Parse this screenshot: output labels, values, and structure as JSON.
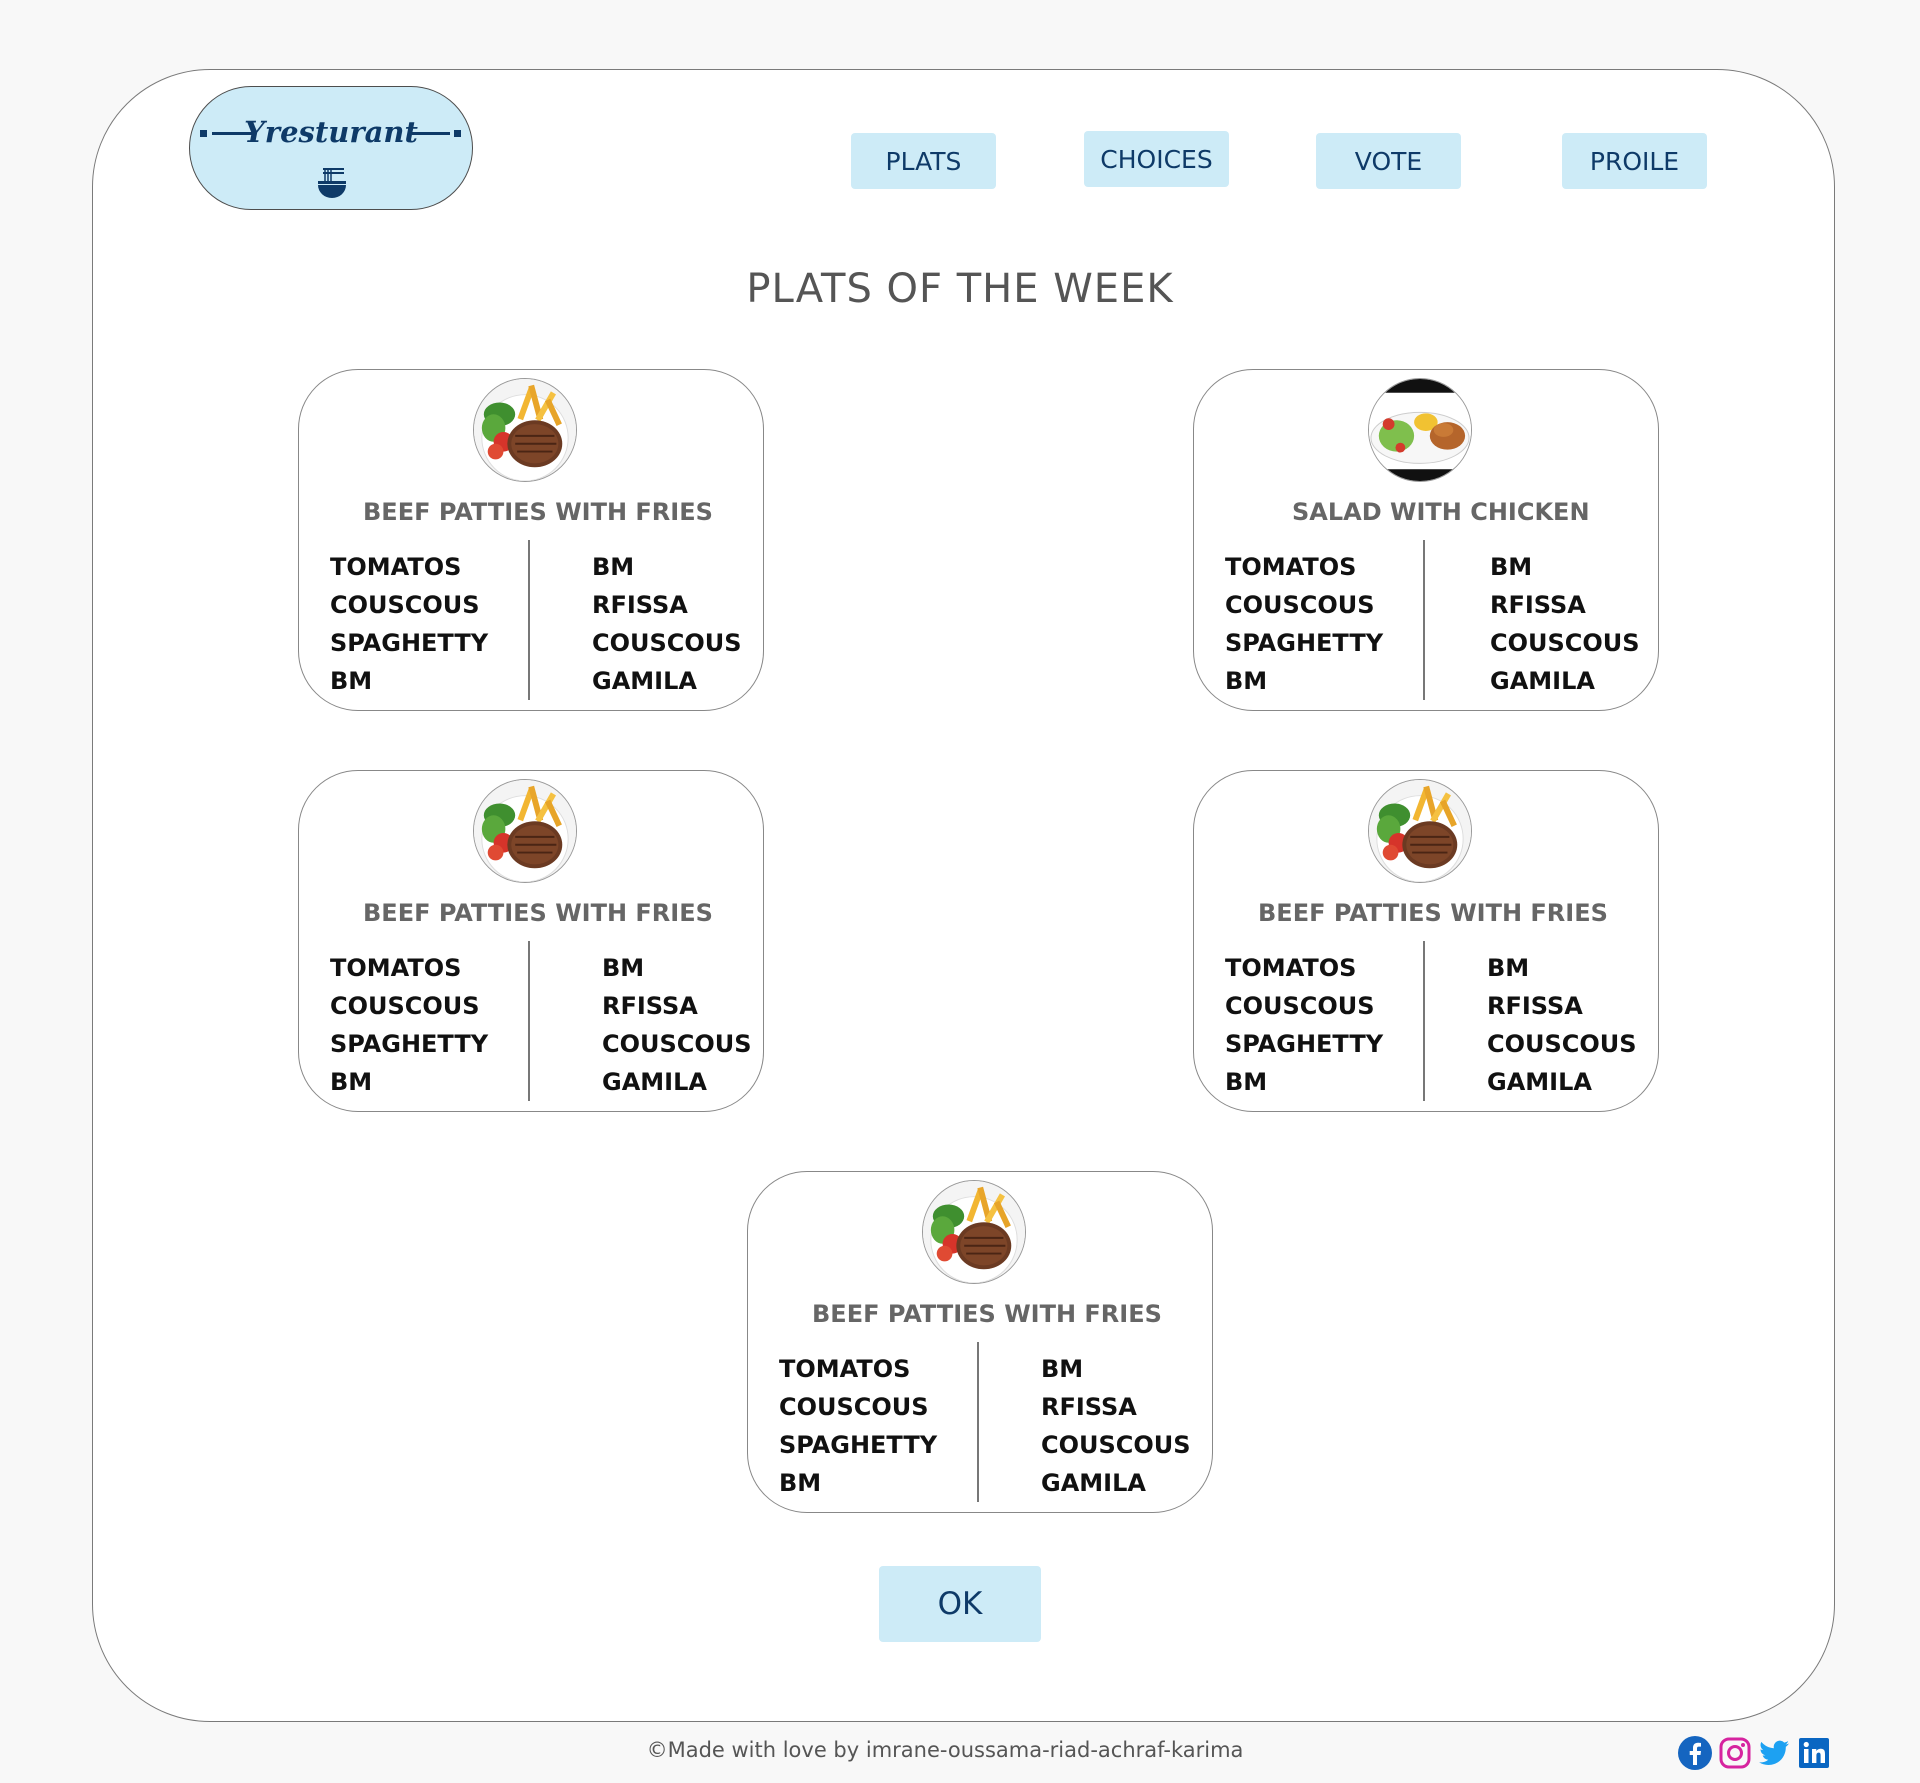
{
  "brand": {
    "name": "Yresturant",
    "icon": "noodle-bowl-icon",
    "color": "#0e3a68",
    "accent": "#cdebf7"
  },
  "nav": {
    "items": [
      "PLATS",
      "CHOICES",
      "VOTE",
      "PROILE"
    ]
  },
  "page": {
    "title": "PLATS OF THE WEEK"
  },
  "cards": [
    {
      "image": "beef-patties-image",
      "title": "BEEF PATTIES WITH FRIES",
      "left": [
        "TOMATOS",
        "COUSCOUS",
        "SPAGHETTY",
        "BM"
      ],
      "right": [
        "BM",
        "RFISSA",
        "COUSCOUS",
        "GAMILA"
      ]
    },
    {
      "image": "salad-chicken-image",
      "title": "SALAD WITH CHICKEN",
      "left": [
        "TOMATOS",
        "COUSCOUS",
        "SPAGHETTY",
        "BM"
      ],
      "right": [
        "BM",
        "RFISSA",
        "COUSCOUS",
        "GAMILA"
      ]
    },
    {
      "image": "beef-patties-image",
      "title": "BEEF PATTIES WITH FRIES",
      "left": [
        "TOMATOS",
        "COUSCOUS",
        "SPAGHETTY",
        "BM"
      ],
      "right": [
        "BM",
        "RFISSA",
        "COUSCOUS",
        "GAMILA"
      ]
    },
    {
      "image": "beef-patties-image",
      "title": "BEEF PATTIES WITH FRIES",
      "left": [
        "TOMATOS",
        "COUSCOUS",
        "SPAGHETTY",
        "BM"
      ],
      "right": [
        "BM",
        "RFISSA",
        "COUSCOUS",
        "GAMILA"
      ]
    },
    {
      "image": "beef-patties-image",
      "title": "BEEF PATTIES WITH FRIES",
      "left": [
        "TOMATOS",
        "COUSCOUS",
        "SPAGHETTY",
        "BM"
      ],
      "right": [
        "BM",
        "RFISSA",
        "COUSCOUS",
        "GAMILA"
      ]
    }
  ],
  "actions": {
    "ok_label": "OK"
  },
  "footer": {
    "text": "©Made with love by  imrane-oussama-riad-achraf-karima",
    "social": [
      "facebook-icon",
      "instagram-icon",
      "twitter-icon",
      "linkedin-icon"
    ]
  }
}
